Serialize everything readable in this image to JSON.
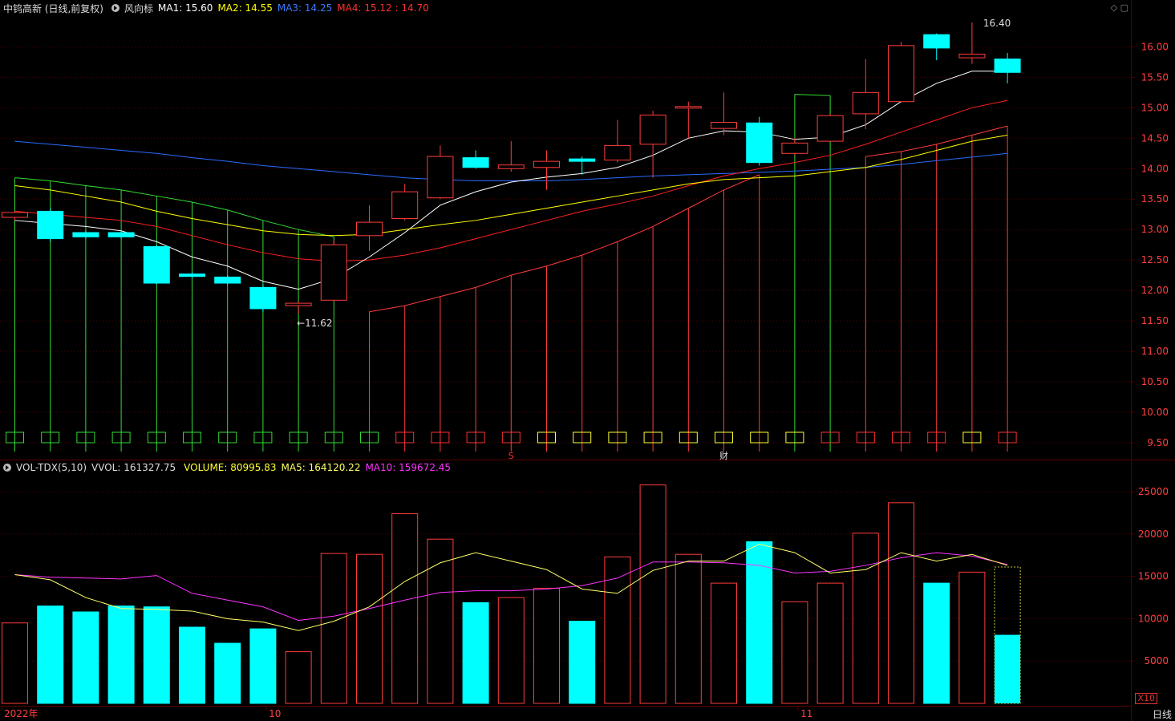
{
  "header": {
    "stock_title": "中钨高新 (日线,前复权)",
    "indicator_name": "风向标",
    "ma1_label": "MA1: 15.60",
    "ma2_label": "MA2: 14.55",
    "ma3_label": "MA3: 14.25",
    "ma4_label": "MA4: 15.12 : 14.70"
  },
  "volume_header": {
    "name": "VOL-TDX(5,10)",
    "vvol_label": "VVOL: 161327.75",
    "volume_label": "VOLUME: 80995.83",
    "ma5_label": "MA5: 164120.22",
    "ma10_label": "MA10: 159672.45"
  },
  "annotations": {
    "high_label": "16.40",
    "low_label": "←11.62",
    "event_s": "S",
    "event_cai": "财"
  },
  "x_axis": {
    "labels": [
      "2022年",
      "10",
      "11"
    ],
    "timeframe": "日线",
    "x10_badge": "X10"
  },
  "colors": {
    "up": "#ff3c3c",
    "down": "#00ffff",
    "ma1": "#ffffff",
    "ma2": "#ffff00",
    "ma3": "#2a6cff",
    "ma4": "#ff2020",
    "wind_up": "#ff3c3c",
    "wind_down": "#33dd33",
    "vol_ma5": "#ffff66",
    "vol_ma10": "#ff33ff",
    "grid": "#5a0000",
    "axis_text": "#ff4040"
  },
  "chart_data": [
    {
      "type": "candlestick",
      "title": "中钨高新 (日线,前复权)",
      "ylim": [
        9.5,
        16.4
      ],
      "y_ticks": [
        9.5,
        10.0,
        10.5,
        11.0,
        11.5,
        12.0,
        12.5,
        13.0,
        13.5,
        14.0,
        14.5,
        15.0,
        15.5,
        16.0
      ],
      "candles": [
        {
          "open": 13.2,
          "close": 13.28,
          "high": 13.3,
          "low": 13.15
        },
        {
          "open": 13.3,
          "close": 12.85,
          "high": 13.35,
          "low": 12.8
        },
        {
          "open": 12.95,
          "close": 12.88,
          "high": 12.98,
          "low": 12.85
        },
        {
          "open": 12.95,
          "close": 12.88,
          "high": 12.98,
          "low": 12.85
        },
        {
          "open": 12.72,
          "close": 12.12,
          "high": 12.75,
          "low": 12.1
        },
        {
          "open": 12.27,
          "close": 12.23,
          "high": 12.3,
          "low": 12.2
        },
        {
          "open": 12.22,
          "close": 12.12,
          "high": 12.25,
          "low": 12.1
        },
        {
          "open": 12.05,
          "close": 11.7,
          "high": 12.1,
          "low": 11.65
        },
        {
          "open": 11.75,
          "close": 11.79,
          "high": 11.82,
          "low": 11.62
        },
        {
          "open": 11.84,
          "close": 12.75,
          "high": 12.82,
          "low": 11.82
        },
        {
          "open": 12.9,
          "close": 13.12,
          "high": 13.4,
          "low": 12.65
        },
        {
          "open": 13.18,
          "close": 13.62,
          "high": 13.75,
          "low": 13.15
        },
        {
          "open": 13.52,
          "close": 14.2,
          "high": 14.38,
          "low": 13.5
        },
        {
          "open": 14.18,
          "close": 14.02,
          "high": 14.3,
          "low": 14.0
        },
        {
          "open": 14.0,
          "close": 14.06,
          "high": 14.45,
          "low": 13.95
        },
        {
          "open": 14.02,
          "close": 14.12,
          "high": 14.3,
          "low": 13.65
        },
        {
          "open": 14.16,
          "close": 14.12,
          "high": 14.2,
          "low": 13.9
        },
        {
          "open": 14.14,
          "close": 14.38,
          "high": 14.8,
          "low": 14.1
        },
        {
          "open": 14.4,
          "close": 14.88,
          "high": 14.95,
          "low": 13.85
        },
        {
          "open": 15.0,
          "close": 15.02,
          "high": 15.1,
          "low": 14.5
        },
        {
          "open": 14.66,
          "close": 14.76,
          "high": 15.25,
          "low": 14.55
        },
        {
          "open": 14.75,
          "close": 14.1,
          "high": 14.85,
          "low": 14.05
        },
        {
          "open": 14.25,
          "close": 14.42,
          "high": 14.5,
          "low": 14.22
        },
        {
          "open": 14.45,
          "close": 14.87,
          "high": 14.9,
          "low": 14.45
        },
        {
          "open": 14.9,
          "close": 15.25,
          "high": 15.8,
          "low": 14.65
        },
        {
          "open": 15.1,
          "close": 16.02,
          "high": 16.08,
          "low": 15.08
        },
        {
          "open": 16.2,
          "close": 15.98,
          "high": 16.22,
          "low": 15.78
        },
        {
          "open": 15.82,
          "close": 15.88,
          "high": 16.4,
          "low": 15.72
        },
        {
          "open": 15.8,
          "close": 15.58,
          "high": 15.9,
          "low": 15.4
        }
      ],
      "ma1": [
        13.15,
        13.1,
        13.05,
        12.98,
        12.8,
        12.55,
        12.4,
        12.15,
        12.02,
        12.2,
        12.55,
        12.95,
        13.4,
        13.62,
        13.78,
        13.86,
        13.92,
        14.02,
        14.22,
        14.5,
        14.62,
        14.6,
        14.48,
        14.52,
        14.72,
        15.1,
        15.4,
        15.6,
        15.6
      ],
      "ma2": [
        13.72,
        13.65,
        13.55,
        13.45,
        13.3,
        13.18,
        13.08,
        12.98,
        12.92,
        12.9,
        12.92,
        13.0,
        13.08,
        13.15,
        13.25,
        13.35,
        13.45,
        13.55,
        13.65,
        13.75,
        13.82,
        13.85,
        13.88,
        13.95,
        14.02,
        14.15,
        14.3,
        14.45,
        14.55
      ],
      "ma3": [
        14.45,
        14.4,
        14.35,
        14.3,
        14.25,
        14.18,
        14.12,
        14.05,
        14.0,
        13.95,
        13.9,
        13.85,
        13.82,
        13.8,
        13.8,
        13.8,
        13.82,
        13.85,
        13.88,
        13.9,
        13.92,
        13.94,
        13.96,
        13.99,
        14.02,
        14.07,
        14.13,
        14.19,
        14.25
      ],
      "ma4": [
        13.3,
        13.25,
        13.2,
        13.15,
        13.05,
        12.9,
        12.75,
        12.62,
        12.52,
        12.48,
        12.5,
        12.58,
        12.7,
        12.85,
        13.0,
        13.15,
        13.3,
        13.42,
        13.55,
        13.72,
        13.88,
        14.0,
        14.1,
        14.22,
        14.4,
        14.6,
        14.8,
        15.0,
        15.12
      ],
      "wind_vane": [
        {
          "top": 13.85,
          "color": "green"
        },
        {
          "top": 13.8,
          "color": "green"
        },
        {
          "top": 13.72,
          "color": "green"
        },
        {
          "top": 13.65,
          "color": "green"
        },
        {
          "top": 13.55,
          "color": "green"
        },
        {
          "top": 13.45,
          "color": "green"
        },
        {
          "top": 13.32,
          "color": "green"
        },
        {
          "top": 13.15,
          "color": "green"
        },
        {
          "top": 13.0,
          "color": "green"
        },
        {
          "top": 12.88,
          "color": "green"
        },
        {
          "top": 11.65,
          "color": "red"
        },
        {
          "top": 11.75,
          "color": "red"
        },
        {
          "top": 11.9,
          "color": "red"
        },
        {
          "top": 12.05,
          "color": "red"
        },
        {
          "top": 12.25,
          "color": "red"
        },
        {
          "top": 12.4,
          "color": "red"
        },
        {
          "top": 12.58,
          "color": "red"
        },
        {
          "top": 12.8,
          "color": "red"
        },
        {
          "top": 13.05,
          "color": "red"
        },
        {
          "top": 13.35,
          "color": "red"
        },
        {
          "top": 13.65,
          "color": "red"
        },
        {
          "top": 13.9,
          "color": "red"
        },
        {
          "top": 15.22,
          "color": "green"
        },
        {
          "top": 15.2,
          "color": "green"
        },
        {
          "top": 14.2,
          "color": "red"
        },
        {
          "top": 14.28,
          "color": "red"
        },
        {
          "top": 14.4,
          "color": "red"
        },
        {
          "top": 14.55,
          "color": "red"
        },
        {
          "top": 14.7,
          "color": "red"
        }
      ],
      "markers": [
        "green",
        "green",
        "green",
        "green",
        "green",
        "green",
        "green",
        "green",
        "green",
        "green",
        "green",
        "red",
        "red",
        "red",
        "red",
        "yellow",
        "yellow",
        "yellow",
        "yellow",
        "yellow",
        "yellow",
        "yellow",
        "yellow",
        "red",
        "red",
        "red",
        "red",
        "yellow",
        "red"
      ]
    },
    {
      "type": "bar",
      "title": "VOL-TDX(5,10)",
      "ylim": [
        0,
        27000
      ],
      "y_ticks": [
        5000,
        10000,
        15000,
        20000,
        25000
      ],
      "values": [
        9500,
        11500,
        10800,
        11500,
        11400,
        9000,
        7100,
        8800,
        6100,
        17700,
        17600,
        22400,
        19400,
        11900,
        12500,
        13600,
        9700,
        17300,
        25800,
        17600,
        14200,
        19100,
        12000,
        14200,
        20100,
        23700,
        14200,
        15500,
        16100
      ],
      "filled": [
        0,
        8095
      ],
      "ma5": [
        15200,
        14600,
        12500,
        11200,
        11100,
        10900,
        10000,
        9600,
        8600,
        9700,
        11400,
        14400,
        16600,
        17800,
        16800,
        15800,
        13500,
        13000,
        15700,
        16800,
        16800,
        18800,
        17800,
        15400,
        15800,
        17800,
        16800,
        17600,
        16300
      ],
      "ma10": [
        15200,
        14900,
        14800,
        14700,
        15100,
        13000,
        12200,
        11400,
        9800,
        10300,
        11200,
        12200,
        13100,
        13300,
        13300,
        13500,
        13900,
        14800,
        16700,
        16700,
        16600,
        16300,
        15400,
        15600,
        16300,
        17200,
        17800,
        17400,
        16400
      ]
    }
  ]
}
